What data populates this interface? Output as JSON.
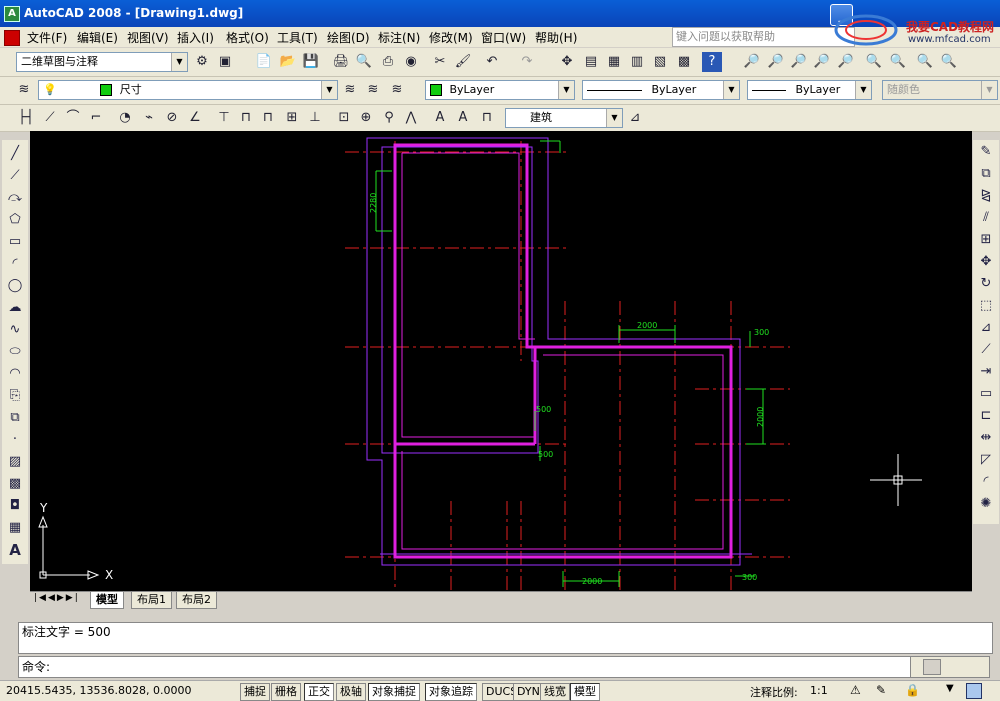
{
  "window": {
    "title": "AutoCAD 2008 - [Drawing1.dwg]",
    "app_icon": "A"
  },
  "menu": [
    {
      "label": "文件(F)"
    },
    {
      "label": "编辑(E)"
    },
    {
      "label": "视图(V)"
    },
    {
      "label": "插入(I)"
    },
    {
      "label": "格式(O)"
    },
    {
      "label": "工具(T)"
    },
    {
      "label": "绘图(D)"
    },
    {
      "label": "标注(N)"
    },
    {
      "label": "修改(M)"
    },
    {
      "label": "窗口(W)"
    },
    {
      "label": "帮助(H)"
    }
  ],
  "help_search": {
    "placeholder": "键入问题以获取帮助"
  },
  "logo": {
    "text": "我要CAD教程网",
    "url": "www.mfcad.com"
  },
  "toolbar": {
    "workspace": "二维草图与注释",
    "layer": "尺寸",
    "color": "ByLayer",
    "linetype": "ByLayer",
    "lineweight": "ByLayer",
    "plotstyle": "随颜色",
    "dimstyle": "建筑"
  },
  "ucs": {
    "x_label": "X",
    "y_label": "Y"
  },
  "drawing": {
    "dims": [
      "2280",
      "2000",
      "300",
      "2000",
      "500",
      "500",
      "2000",
      "300"
    ]
  },
  "tabs": [
    {
      "label": "模型"
    },
    {
      "label": "布局1"
    },
    {
      "label": "布局2"
    }
  ],
  "command": {
    "history": "标注文字 = 500",
    "prompt": "命令:"
  },
  "status": {
    "coords": "20415.5435, 13536.8028, 0.0000",
    "buttons": [
      {
        "label": "捕捉",
        "on": false
      },
      {
        "label": "栅格",
        "on": false
      },
      {
        "label": "正交",
        "on": true
      },
      {
        "label": "极轴",
        "on": false
      },
      {
        "label": "对象捕捉",
        "on": true
      },
      {
        "label": "对象追踪",
        "on": true
      },
      {
        "label": "DUCS",
        "on": false
      },
      {
        "label": "DYN",
        "on": false
      },
      {
        "label": "线宽",
        "on": false
      },
      {
        "label": "模型",
        "on": true
      }
    ],
    "scale_label": "注释比例:",
    "scale_value": "1:1"
  },
  "colors": {
    "wall": "#e020e0",
    "axis": "#e02020",
    "dim": "#20e020",
    "outline": "#9b30ff"
  }
}
